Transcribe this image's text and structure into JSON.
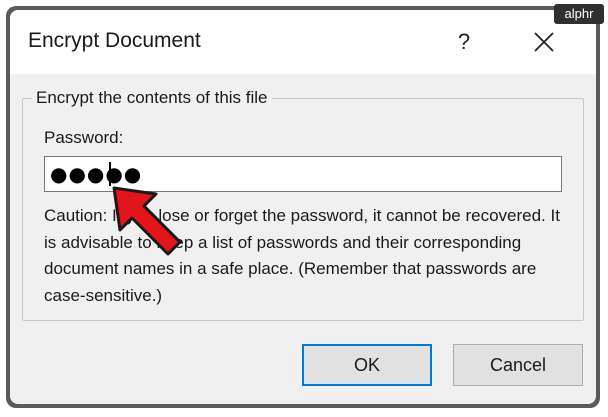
{
  "window": {
    "title": "Encrypt Document",
    "help_label": "?",
    "close_icon": "close-icon"
  },
  "group": {
    "legend": "Encrypt the contents of this file",
    "password_label": "Password:",
    "password_value": "●●●●●",
    "caution": "Caution: If you lose or forget the password, it cannot be recovered. It is advisable to keep a list of passwords and their corresponding document names in a safe place. (Remember that passwords are case-sensitive.)"
  },
  "buttons": {
    "ok_label": "OK",
    "cancel_label": "Cancel"
  },
  "watermark": {
    "brand": "alphr"
  },
  "colors": {
    "accent": "#0078d7",
    "arrow": "#e3141b",
    "dialog_bg": "#f0f0f0"
  }
}
